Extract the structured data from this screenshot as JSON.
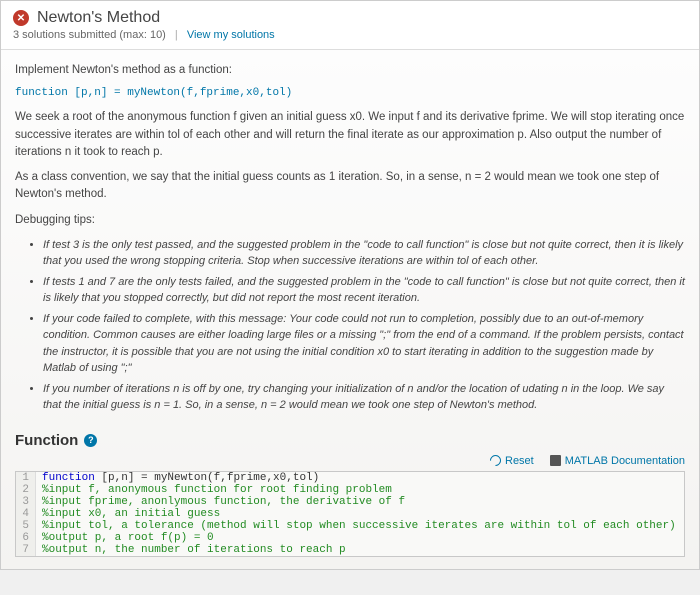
{
  "header": {
    "title": "Newton's Method",
    "subtitle_prefix": "3 solutions submitted (max: 10)",
    "view_link": "View my solutions"
  },
  "content": {
    "intro": "Implement Newton's method as a function:",
    "signature": "function [p,n] = myNewton(f,fprime,x0,tol)",
    "para1": "We seek a root of the anonymous function f given an initial guess x0. We input f and its derivative fprime. We will stop iterating once successive iterates are within tol of each other and will return the final iterate as our approximation p. Also output the number of iterations n it took to reach p.",
    "para2": "As a class convention, we say that the initial guess counts as 1 iteration. So, in a sense, n = 2 would mean we took one step of Newton's method.",
    "debug_label": "Debugging tips:",
    "tips": [
      "If test 3 is the only test passed, and the suggested problem in the \"code to call function\" is close but not quite correct, then it is likely that you used the wrong stopping criteria. Stop when successive iterations are within tol of each other.",
      "If tests 1 and 7 are the only tests failed, and the suggested problem in the \"code to call function\" is close but not quite correct, then it is likely that you stopped correctly, but did not report the most recent iteration.",
      "If your code failed to complete, with this message: Your code could not run to completion, possibly due to an out-of-memory condition. Common causes are either loading large files or a missing \";\" from the end of a command. If the problem persists, contact the instructor, it is possible that you are not using the initial condition x0 to start iterating in addition to the suggestion made by Matlab of using \";\"",
      "If you number of iterations n is off by one, try changing your initialization of n and/or the location of udating n in the loop. We say that the initial guess is n = 1. So, in a sense, n = 2 would mean we took one step of Newton's method."
    ]
  },
  "section": {
    "title": "Function",
    "reset": "Reset",
    "docs": "MATLAB Documentation"
  },
  "editor": {
    "lines": [
      {
        "n": "1",
        "kw": "function ",
        "body": "[p,n] = myNewton(f,fprime,x0,tol)"
      },
      {
        "n": "2",
        "cm": "%input f, anonymous function for root finding problem"
      },
      {
        "n": "3",
        "cm": "%input fprime, anonlymous function, the derivative of f"
      },
      {
        "n": "4",
        "cm": "%input x0, an initial guess"
      },
      {
        "n": "5",
        "cm": "%input tol, a tolerance (method will stop when successive iterates are within tol of each other)"
      },
      {
        "n": "6",
        "cm": "%output p, a root f(p) = 0"
      },
      {
        "n": "7",
        "cm": "%output n, the number of iterations to reach p"
      }
    ]
  }
}
